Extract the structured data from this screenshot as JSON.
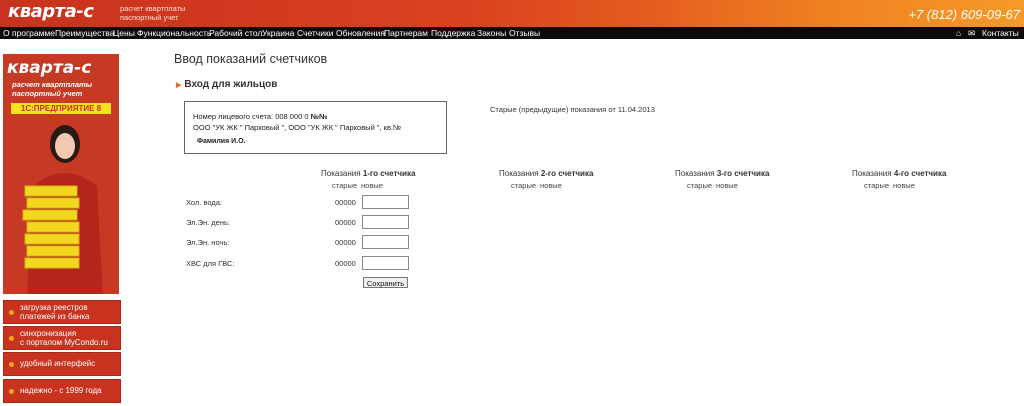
{
  "header": {
    "logo": "кварта-с",
    "tagline_line1": "расчет квартплаты",
    "tagline_line2": "паспортный учет",
    "phone": "+7 (812) 609-09-67"
  },
  "nav": {
    "items": [
      "О программе",
      "Преимущества",
      "Цены",
      "Функциональность",
      "Рабочий стол",
      "Украина",
      "Счетчики",
      "Обновления",
      "Партнерам",
      "Поддержка",
      "Законы",
      "Отзывы"
    ],
    "contacts": "Контакты",
    "icons": [
      "home-icon",
      "mail-icon"
    ]
  },
  "banner": {
    "logo": "кварта-с",
    "sub_line1": "расчет квартплаты",
    "sub_line2": "паспортный учет",
    "badge": "1С:ПРЕДПРИЯТИЕ 8"
  },
  "sidebar": {
    "items": [
      {
        "line1": "загрузка реестров",
        "line2": "платежей из банка"
      },
      {
        "line1": "синхронизация",
        "line2": "с порталом MyCondo.ru"
      },
      {
        "line1": "удобный интерфейс",
        "line2": ""
      },
      {
        "line1": "надежно - с 1999 года",
        "line2": ""
      }
    ]
  },
  "main": {
    "title": "Ввод показаний счетчиков",
    "section": "Вход для жильцов",
    "account": {
      "number_label": "Номер лицевого счета: 008 000 0",
      "number_suffix": "№№",
      "address": "ООО \"УК ЖК \" Парковый \", ООО \"УК ЖК \" Парковый \", кв.№",
      "name": "Фамилия И.О."
    },
    "old_readings_note": "Старые (предыдущие) показания от",
    "old_readings_date": "11.04.2013",
    "meters": [
      {
        "title_prefix": "Показания",
        "title_num": "1-го счетчика"
      },
      {
        "title_prefix": "Показания",
        "title_num": "2-го счетчика"
      },
      {
        "title_prefix": "Показания",
        "title_num": "3-го счетчика"
      },
      {
        "title_prefix": "Показания",
        "title_num": "4-го счетчика"
      }
    ],
    "col_old": "старые",
    "col_new": "новые",
    "rows": [
      {
        "label": "Хол. вода:",
        "old": "00000",
        "new": ""
      },
      {
        "label": "Эл.Эн. день:",
        "old": "00000",
        "new": ""
      },
      {
        "label": "Эл.Эн. ночь:",
        "old": "00000",
        "new": ""
      },
      {
        "label": "ХВС для ГВС:",
        "old": "00000",
        "new": ""
      }
    ],
    "save_label": "Сохранить"
  },
  "colors": {
    "brand_red": "#c8321e",
    "brand_orange": "#f59a2a",
    "nav_black": "#0a0a0a",
    "badge_yellow": "#f7e21d"
  }
}
